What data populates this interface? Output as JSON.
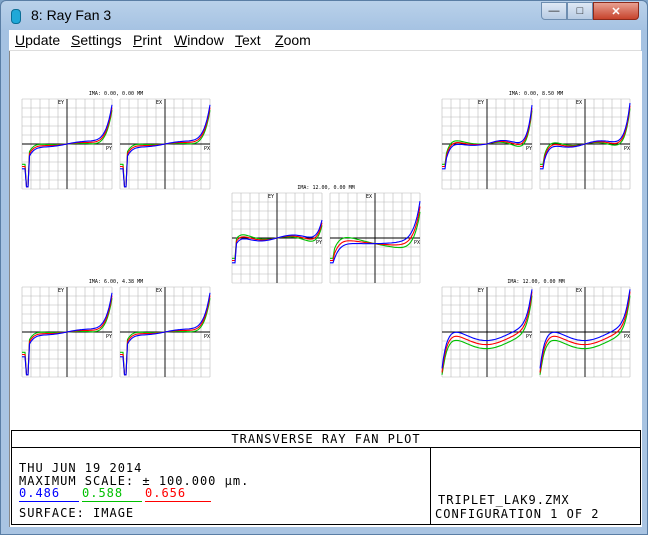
{
  "window": {
    "title": "8: Ray Fan 3"
  },
  "menu": [
    "Update",
    "Settings",
    "Print",
    "Window",
    "Text",
    "Zoom"
  ],
  "plot": {
    "fields": [
      {
        "label": "IMA: 0.00, 0.00 MM"
      },
      {
        "label": "IMA: 0.00, 8.50 MM"
      },
      {
        "label": "IMA: 12.00, 0.00 MM"
      },
      {
        "label": "IMA: 6.00, 4.38 MM"
      },
      {
        "label": "IMA: 12.00, 0.00 MM"
      }
    ],
    "axis": {
      "ey": "EY",
      "ex": "EX",
      "py": "PY",
      "px": "PX"
    }
  },
  "colors": {
    "blue": "#0000ff",
    "green": "#00c000",
    "red": "#ff0000",
    "grid": "#b8b8b8"
  },
  "footer": {
    "title": "TRANSVERSE RAY FAN PLOT",
    "date": "THU JUN 19 2014",
    "scale": "MAXIMUM SCALE: ± 100.000 µm.",
    "wavelengths": [
      {
        "value": "0.486",
        "color": "#0000ff"
      },
      {
        "value": "0.588",
        "color": "#00c000"
      },
      {
        "value": "0.656",
        "color": "#ff0000"
      }
    ],
    "surface": "SURFACE: IMAGE",
    "file": "TRIPLET_LAK9.ZMX",
    "config": "CONFIGURATION 1 OF 2"
  }
}
